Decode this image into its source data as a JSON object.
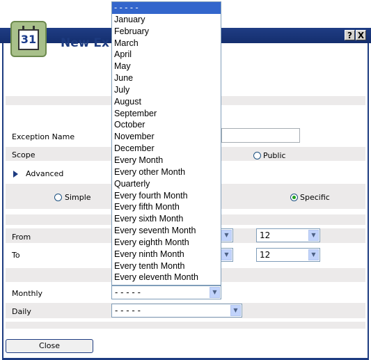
{
  "window": {
    "help_label": "?",
    "close_label": "X",
    "heading": "New Ex"
  },
  "icon": {
    "date": "31"
  },
  "form": {
    "exception_name_label": "Exception Name",
    "scope_label": "Scope",
    "public_label": "Public",
    "advanced_label": "Advanced",
    "simple_label": "Simple",
    "specific_label": "Specific",
    "from_label": "From",
    "to_label": "To",
    "from_hour": "12",
    "to_hour": "12",
    "monthly_label": "Monthly",
    "monthly_value": "- - - - -",
    "daily_label": "Daily",
    "daily_value": "- - - - -",
    "close_button": "Close"
  },
  "dropdown": {
    "selected": "- - - - -",
    "options": [
      "January",
      "February",
      "March",
      "April",
      "May",
      "June",
      "July",
      "August",
      "September",
      "October",
      "November",
      "December",
      "Every Month",
      "Every other Month",
      "Quarterly",
      "Every fourth Month",
      "Every fifth Month",
      "Every sixth Month",
      "Every seventh Month",
      "Every eighth Month",
      "Every ninth Month",
      "Every tenth Month",
      "Every eleventh Month"
    ]
  }
}
